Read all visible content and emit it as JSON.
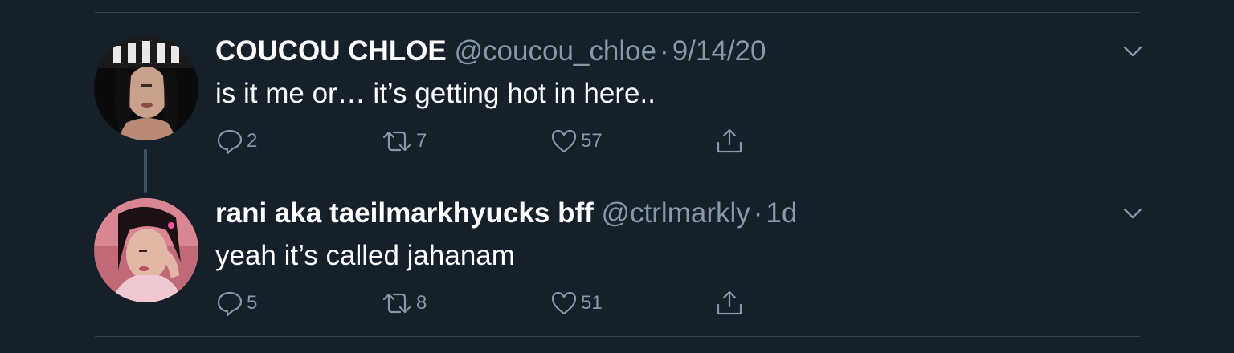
{
  "tweets": [
    {
      "display_name": "COUCOU CHLOE",
      "handle": "@coucou_chloe",
      "separator": "·",
      "time": "9/14/20",
      "text": "is it me or… it’s getting hot in here..",
      "reply_count": "2",
      "retweet_count": "7",
      "like_count": "57"
    },
    {
      "display_name": "rani aka taeilmarkhyucks bff",
      "handle": "@ctrlmarkly",
      "separator": "·",
      "time": "1d",
      "text": "yeah it’s called jahanam",
      "reply_count": "5",
      "retweet_count": "8",
      "like_count": "51"
    }
  ],
  "icons": {
    "reply": "reply-icon",
    "retweet": "retweet-icon",
    "like": "heart-icon",
    "share": "share-icon",
    "more": "chevron-down-icon"
  },
  "colors": {
    "background": "#15202b",
    "secondary_text": "#8899a6",
    "divider": "#38444d",
    "thread_line": "#3d5466"
  }
}
